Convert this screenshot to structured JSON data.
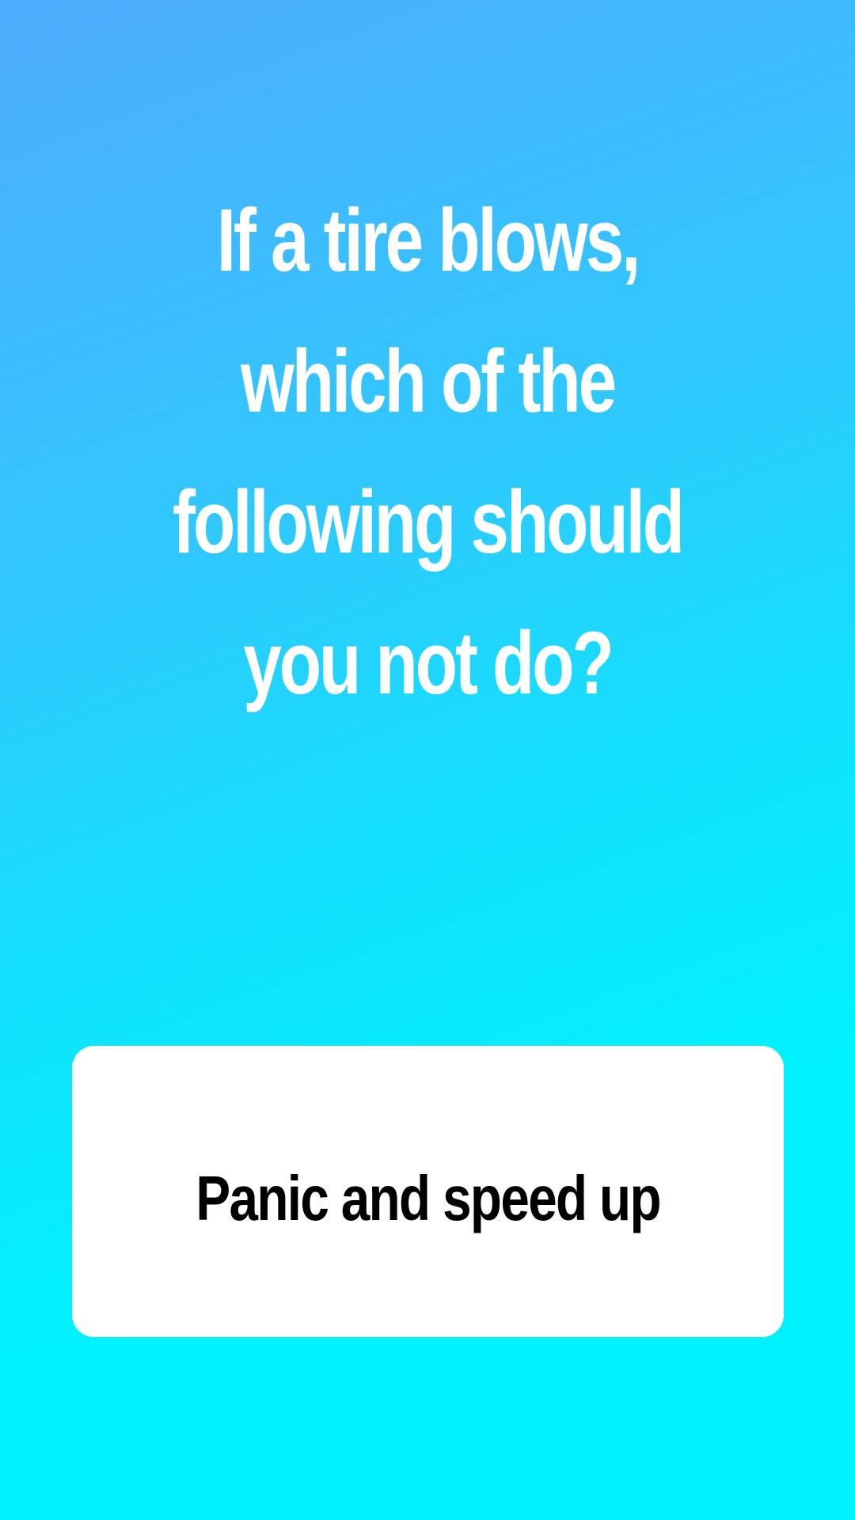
{
  "question": {
    "text": "If a tire blows, which of the following should you not do?"
  },
  "answer": {
    "label": "Panic and speed up"
  },
  "colors": {
    "gradient_top": "#4facfe",
    "gradient_bottom": "#00f2fe",
    "question_text": "#ffffff",
    "card_background": "#ffffff",
    "answer_text": "#000000"
  }
}
